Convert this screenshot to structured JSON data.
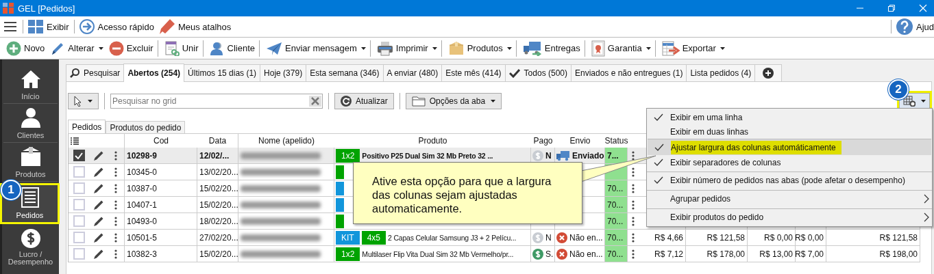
{
  "window": {
    "title": "GEL [Pedidos]"
  },
  "quick_bar": {
    "items": [
      {
        "label": "Exibir"
      },
      {
        "label": "Acesso rápido"
      },
      {
        "label": "Meus atalhos"
      }
    ],
    "help": {
      "label": "Ajud"
    }
  },
  "toolbar": [
    {
      "label": "Novo",
      "has_menu": false
    },
    {
      "label": "Alterar",
      "has_menu": true
    },
    {
      "label": "Excluir",
      "has_menu": false,
      "separator_after": true
    },
    {
      "label": "Unir",
      "has_menu": false,
      "separator_after": true
    },
    {
      "label": "Cliente",
      "has_menu": false,
      "separator_after": true
    },
    {
      "label": "Enviar mensagem",
      "has_menu": true,
      "separator_after": true
    },
    {
      "label": "Imprimir",
      "has_menu": true,
      "separator_after": true
    },
    {
      "label": "Produtos",
      "has_menu": true,
      "separator_after": true
    },
    {
      "label": "Entregas",
      "has_menu": false,
      "separator_after": true
    },
    {
      "label": "Garantia",
      "has_menu": true,
      "separator_after": true
    },
    {
      "label": "Exportar",
      "has_menu": true
    }
  ],
  "sidebar": [
    {
      "label": "Início",
      "selected": false,
      "highlighted": false
    },
    {
      "label": "Clientes",
      "selected": false,
      "highlighted": false
    },
    {
      "label": "Produtos",
      "selected": false,
      "highlighted": false
    },
    {
      "label": "Pedidos",
      "selected": true,
      "highlighted": true
    },
    {
      "label": "Lucro / Desempenho",
      "selected": false,
      "highlighted": false
    }
  ],
  "tabs": [
    {
      "label": "Pesquisar",
      "kind": "search",
      "selected": false
    },
    {
      "label": "Abertos (254)",
      "kind": "text",
      "selected": true
    },
    {
      "label": "Últimos 15 dias (1)",
      "kind": "text",
      "selected": false
    },
    {
      "label": "Hoje (379)",
      "kind": "text",
      "selected": false
    },
    {
      "label": "Esta semana (346)",
      "kind": "text",
      "selected": false
    },
    {
      "label": "A enviar (480)",
      "kind": "text",
      "selected": false
    },
    {
      "label": "Este mês (414)",
      "kind": "text",
      "selected": false
    },
    {
      "label": "Todos (500)",
      "kind": "check",
      "selected": false
    },
    {
      "label": "Enviados e não entregues (1)",
      "kind": "text",
      "selected": false
    },
    {
      "label": "Lista pedidos (4)",
      "kind": "text",
      "selected": false
    }
  ],
  "grid_toolbar": {
    "search": {
      "placeholder": "Pesquisar no grid"
    },
    "refresh": {
      "label": "Atualizar"
    },
    "tab_options": {
      "label": "Opções da aba"
    },
    "settings": {
      "highlighted": true
    }
  },
  "subtabs": [
    {
      "label": "Pedidos",
      "selected": true
    },
    {
      "label": "Produtos do pedido",
      "selected": false
    }
  ],
  "grid": {
    "columns": [
      "Cod",
      "Data",
      "Nome (apelido)",
      "Produto",
      "Pago",
      "Envio",
      "Status"
    ],
    "rows": [
      {
        "selected": true,
        "checked": true,
        "cod": "10298-9",
        "data": "12/02/...",
        "products": [
          {
            "text": "1x2",
            "color": "#00a300"
          }
        ],
        "product": "Positivo P25 Dual Sim 32 Mb Preto 32 ...",
        "pago": {
          "kind": "unpaid",
          "text": "N"
        },
        "envio": {
          "kind": "sent",
          "text": "Enviado"
        },
        "status": "7..."
      },
      {
        "selected": false,
        "checked": false,
        "cod": "10345-0",
        "data": "13/02/20...",
        "products": [
          {
            "color": "#00a300"
          }
        ]
      },
      {
        "selected": false,
        "checked": false,
        "cod": "10387-0",
        "data": "15/02/20...",
        "products": [
          {
            "color": "#1296db"
          }
        ],
        "status": "70..."
      },
      {
        "selected": false,
        "checked": false,
        "cod": "10407-1",
        "data": "15/02/20...",
        "products": [
          {
            "color": "#1296db"
          }
        ],
        "status": "70..."
      },
      {
        "selected": false,
        "checked": false,
        "cod": "10493-0",
        "data": "18/02/20...",
        "products": [
          {
            "color": "#00a300"
          }
        ],
        "status": "70..."
      },
      {
        "selected": false,
        "checked": false,
        "cod": "10501-5",
        "data": "27/02/20...",
        "products": [
          {
            "text": "KIT",
            "color": "#1296db"
          },
          {
            "text": "4x5",
            "color": "#00a300"
          }
        ],
        "product": "2 Capas Celular Samsung J3 + 2 Pelícu...",
        "pago": {
          "kind": "unpaid",
          "text": "N"
        },
        "envio": {
          "kind": "not_sent",
          "text": "Não en..."
        },
        "status": "70...",
        "values": [
          "R$ 4,66",
          "R$ 121,58",
          "R$ 0,00",
          "R$ 0,00",
          "R$ 121,58"
        ]
      },
      {
        "selected": false,
        "checked": false,
        "cod": "10382-3",
        "data": "15/02/20...",
        "products": [
          {
            "text": "1x2",
            "color": "#00a300"
          }
        ],
        "product": "Multilaser Flip Vita Dual Sim 32 Mb Vermelho/pr...",
        "pago": {
          "kind": "paid",
          "text": "S."
        },
        "envio": {
          "kind": "not_sent",
          "text": "Não en..."
        },
        "status": "70...",
        "values": [
          "R$ 7,12",
          "R$ 178,00",
          "R$ 13,00",
          "R$ 7,00",
          "R$ 198,00"
        ]
      }
    ]
  },
  "menu": {
    "items": [
      {
        "label": "Exibir em uma linha",
        "checked": true,
        "highlighted": false,
        "submenu": false,
        "separator_before": false
      },
      {
        "label": "Exibir em duas linhas",
        "checked": false,
        "highlighted": false,
        "submenu": false,
        "separator_before": false
      },
      {
        "label": "Ajustar largura das colunas automáticamente",
        "checked": true,
        "highlighted": true,
        "submenu": false,
        "separator_before": true
      },
      {
        "label": "Exibir separadores de colunas",
        "checked": true,
        "highlighted": false,
        "submenu": false,
        "separator_before": false
      },
      {
        "label": "Exibir número de pedidos nas abas (pode afetar o desempenho)",
        "checked": true,
        "highlighted": false,
        "submenu": false,
        "separator_before": true
      },
      {
        "label": "Agrupar pedidos",
        "checked": false,
        "highlighted": false,
        "submenu": true,
        "separator_before": true
      },
      {
        "label": "Exibir produtos do pedido",
        "checked": false,
        "highlighted": false,
        "submenu": true,
        "separator_before": true
      }
    ]
  },
  "callout": {
    "text": "Ative esta opção para que a largura das colunas sejam ajustadas automaticamente."
  },
  "annotations": [
    {
      "number": "1"
    },
    {
      "number": "2"
    }
  ]
}
